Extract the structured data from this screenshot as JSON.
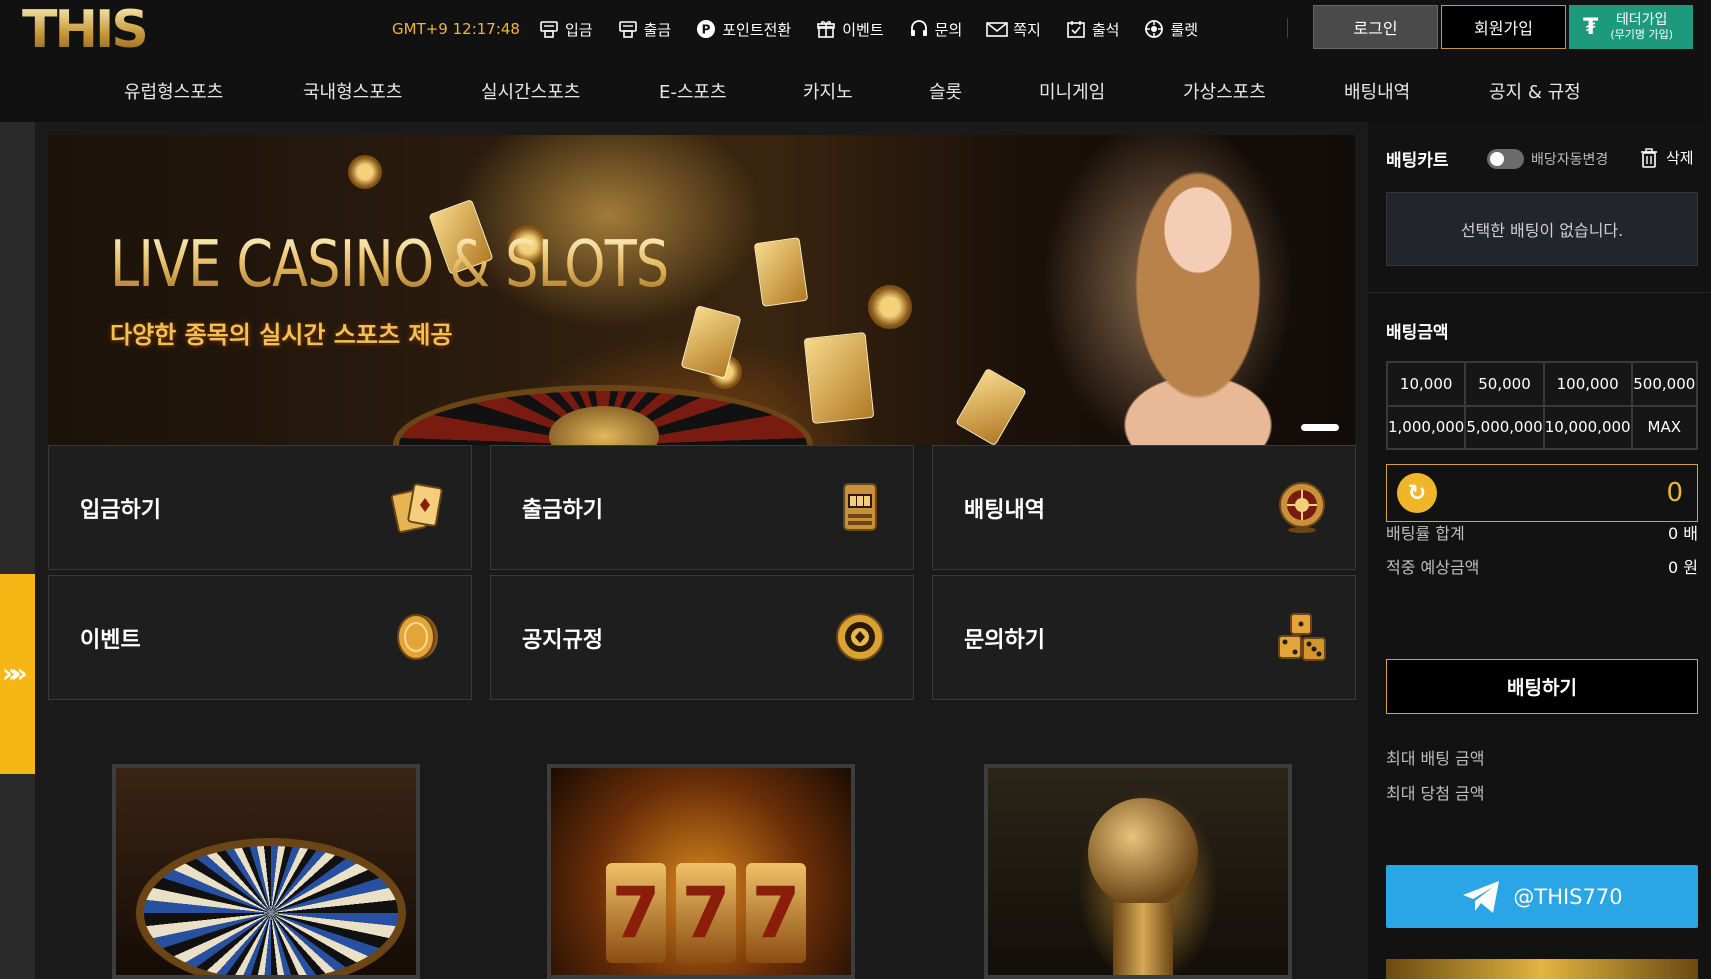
{
  "brand": {
    "logo_text": "THIS"
  },
  "header": {
    "clock": "GMT+9 12:17:48",
    "top_nav": [
      {
        "label": "입금",
        "icon": "deposit-icon"
      },
      {
        "label": "출금",
        "icon": "withdraw-icon"
      },
      {
        "label": "포인트전환",
        "icon": "point-icon"
      },
      {
        "label": "이벤트",
        "icon": "gift-icon"
      },
      {
        "label": "문의",
        "icon": "headset-icon"
      },
      {
        "label": "쪽지",
        "icon": "mail-icon"
      },
      {
        "label": "출석",
        "icon": "calendar-check-icon"
      },
      {
        "label": "룰렛",
        "icon": "roulette-icon"
      }
    ],
    "login_label": "로그인",
    "join_label": "회원가입",
    "tether_label": "테더가입",
    "tether_sub": "(무기명 가입)"
  },
  "main_nav": [
    "유럽형스포츠",
    "국내형스포츠",
    "실시간스포츠",
    "E-스포츠",
    "카지노",
    "슬롯",
    "미니게임",
    "가상스포츠",
    "배팅내역",
    "공지 & 규정"
  ],
  "banner": {
    "title": "LIVE CASINO & SLOTS",
    "subtitle": "다양한 종목의 실시간 스포츠 제공"
  },
  "quick_tiles": [
    {
      "label": "입금하기",
      "icon": "cards-icon"
    },
    {
      "label": "출금하기",
      "icon": "slot-machine-icon"
    },
    {
      "label": "배팅내역",
      "icon": "roulette-wheel-icon"
    },
    {
      "label": "이벤트",
      "icon": "coin-icon"
    },
    {
      "label": "공지규정",
      "icon": "chip-icon"
    },
    {
      "label": "문의하기",
      "icon": "dice-icon"
    }
  ],
  "game_cards": [
    {
      "name": "roulette",
      "reels": []
    },
    {
      "name": "slots",
      "reels": [
        "7",
        "7",
        "7"
      ]
    },
    {
      "name": "sports",
      "reels": []
    }
  ],
  "bet_slip": {
    "title": "배팅카트",
    "auto_odds_label": "배당자동변경",
    "auto_odds_on": false,
    "delete_label": "삭제",
    "empty_message": "선택한 배팅이 없습니다.",
    "amount_title": "배팅금액",
    "amount_buttons": [
      "10,000",
      "50,000",
      "100,000",
      "500,000",
      "1,000,000",
      "5,000,000",
      "10,000,000",
      "MAX"
    ],
    "amount_value": "0",
    "odds_total_label": "배팅률 합계",
    "odds_total_value": "0 배",
    "expected_label": "적중 예상금액",
    "expected_value": "0 원",
    "bet_button": "배팅하기",
    "max_bet_label": "최대 배팅 금액",
    "max_win_label": "최대 당첨 금액",
    "telegram_handle": "@THIS770"
  },
  "colors": {
    "accent_gold": "#d9a233",
    "clock": "#f0b43c",
    "tether": "#1d9a7c",
    "telegram": "#2aa6e6",
    "side_tab": "#f5b616"
  }
}
